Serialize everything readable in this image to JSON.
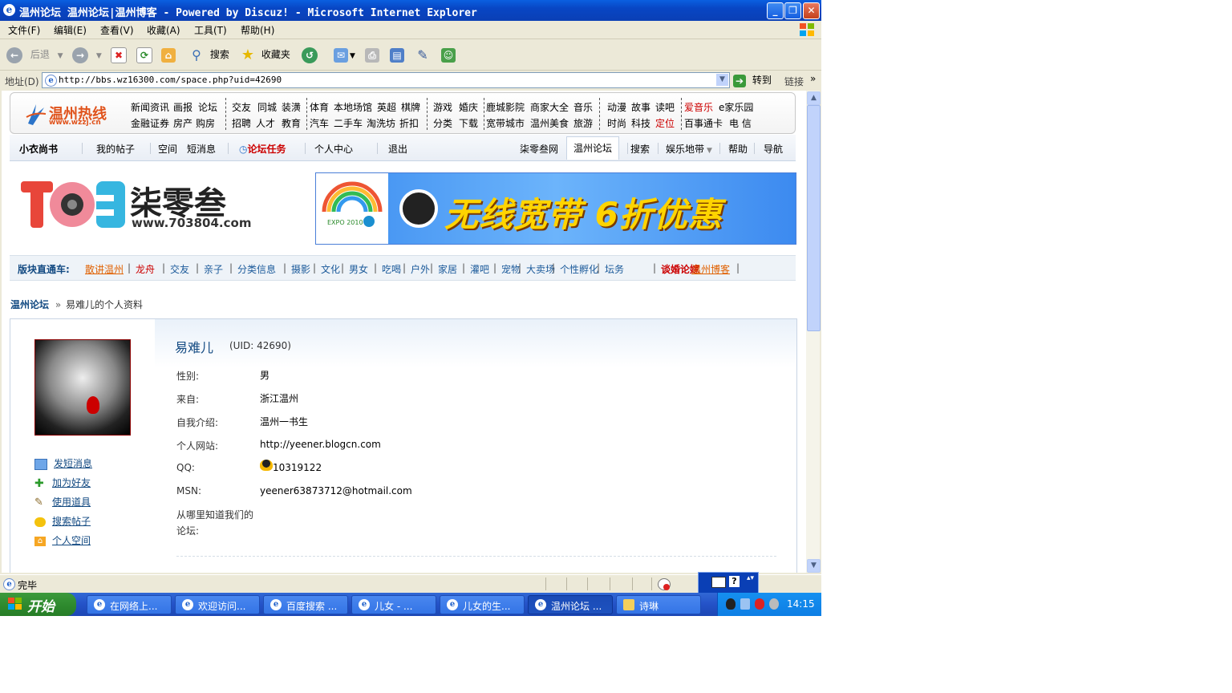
{
  "window": {
    "title": "温州论坛 温州论坛|温州博客 - Powered by Discuz! - Microsoft Internet Explorer",
    "icon": "ie-icon"
  },
  "menu": [
    "文件(F)",
    "编辑(E)",
    "查看(V)",
    "收藏(A)",
    "工具(T)",
    "帮助(H)"
  ],
  "toolbar": {
    "back": "后退",
    "search": "搜索",
    "favorites": "收藏夹"
  },
  "address": {
    "label": "地址(D)",
    "url": "http://bbs.wz16300.com/space.php?uid=42690",
    "go": "转到",
    "links": "链接"
  },
  "site_header": {
    "logo_text": "温州热线",
    "logo_url": "www.wzzj.cn",
    "links_row1": [
      "新闻资讯",
      "画报",
      "论坛",
      "交友",
      "同城",
      "装潢",
      "体育",
      "本地场馆",
      "英超",
      "棋牌",
      "游戏",
      "婚庆",
      "鹿城影院",
      "商家大全",
      "音乐",
      "动漫",
      "故事",
      "读吧",
      "爱音乐",
      "e家乐园"
    ],
    "links_row2": [
      "金融证券",
      "房产",
      "购房",
      "招聘",
      "人才",
      "教育",
      "汽车",
      "二手车",
      "淘洗坊",
      "折扣",
      "分类",
      "下载",
      "宽带城市",
      "温州美食",
      "旅游",
      "时尚",
      "科技",
      "定位",
      "百事通卡",
      "电 信"
    ]
  },
  "nav": {
    "user": "小衣尚书",
    "left": [
      "我的帖子",
      "空间",
      "短消息",
      "论坛任务",
      "个人中心",
      "退出"
    ],
    "right": [
      "柒零叁网",
      "温州论坛",
      "搜索",
      "娱乐地带",
      "帮助",
      "导航"
    ]
  },
  "banners": {
    "logo703_text": "柒零叁",
    "logo703_url": "www.703804.com",
    "ad_text": "无线宽带 6折优惠",
    "ad_expo": "EXPO 2010"
  },
  "board_bar": {
    "title": "版块直通车:",
    "items": [
      "散讲温州",
      "龙舟",
      "交友",
      "亲子",
      "分类信息",
      "摄影",
      "文化",
      "男女",
      "吃喝",
      "户外",
      "家居",
      "灌吧",
      "宠物",
      "大卖场",
      "个性孵化",
      "坛务",
      "谈婚论嫁",
      "温州博客"
    ]
  },
  "breadcrumb": {
    "home": "温州论坛",
    "sep": "»",
    "current": "易难儿的个人资料"
  },
  "profile": {
    "username": "易难儿",
    "uid": "(UID: 42690)",
    "actions": [
      "发短消息",
      "加为好友",
      "使用道具",
      "搜索帖子",
      "个人空间"
    ],
    "fields": [
      {
        "label": "性别:",
        "value": "男"
      },
      {
        "label": "来自:",
        "value": "浙江温州"
      },
      {
        "label": "自我介绍:",
        "value": "温州一书生"
      },
      {
        "label": "个人网站:",
        "value": "http://yeener.blogcn.com"
      },
      {
        "label": "QQ:",
        "value": "10319122"
      },
      {
        "label": "MSN:",
        "value": "yeener63873712@hotmail.com"
      }
    ],
    "source_label_l1": "从哪里知道我们的",
    "source_label_l2": "论坛:"
  },
  "status": {
    "text": "完毕"
  },
  "taskbar": {
    "start": "开始",
    "tasks": [
      "在网络上...",
      "欢迎访问...",
      "百度搜索 ...",
      "儿女 - ...",
      "儿女的生...",
      "温州论坛 ...",
      "诗琳"
    ],
    "clock": "14:15"
  },
  "colors": {
    "link": "#134a82",
    "accent_red": "#cc0000",
    "xp_blue": "#0a5fe0"
  }
}
